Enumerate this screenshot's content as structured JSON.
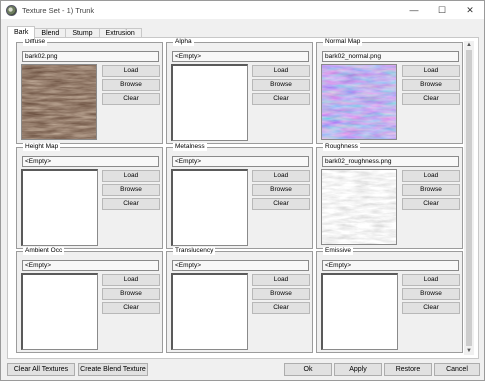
{
  "window": {
    "title": "Texture Set - 1) Trunk",
    "minimize": "—",
    "maximize": "☐",
    "close": "✕"
  },
  "tabs": [
    {
      "label": "Bark",
      "active": true
    },
    {
      "label": "Blend",
      "active": false
    },
    {
      "label": "Stump",
      "active": false
    },
    {
      "label": "Extrusion",
      "active": false
    }
  ],
  "buttons": {
    "load": "Load",
    "browse": "Browse",
    "clear": "Clear"
  },
  "groups": [
    {
      "title": "Diffuse",
      "file": "bark02.png",
      "preview": "bark"
    },
    {
      "title": "Alpha",
      "file": "<Empty>",
      "preview": "empty"
    },
    {
      "title": "Normal Map",
      "file": "bark02_normal.png",
      "preview": "normal"
    },
    {
      "title": "Height Map",
      "file": "<Empty>",
      "preview": "empty"
    },
    {
      "title": "Metalness",
      "file": "<Empty>",
      "preview": "empty"
    },
    {
      "title": "Roughness",
      "file": "bark02_roughness.png",
      "preview": "roughness"
    },
    {
      "title": "Ambient Occ",
      "file": "<Empty>",
      "preview": "empty"
    },
    {
      "title": "Translucency",
      "file": "<Empty>",
      "preview": "empty"
    },
    {
      "title": "Emissive",
      "file": "<Empty>",
      "preview": "empty"
    }
  ],
  "footer": {
    "clear_all": "Clear All Textures",
    "create_blend": "Create Blend Texture",
    "ok": "Ok",
    "apply": "Apply",
    "restore": "Restore",
    "cancel": "Cancel"
  },
  "colors": {
    "bark": "#8a6a52",
    "normal": "#7a78e0",
    "roughness": "#b8b8b8"
  }
}
